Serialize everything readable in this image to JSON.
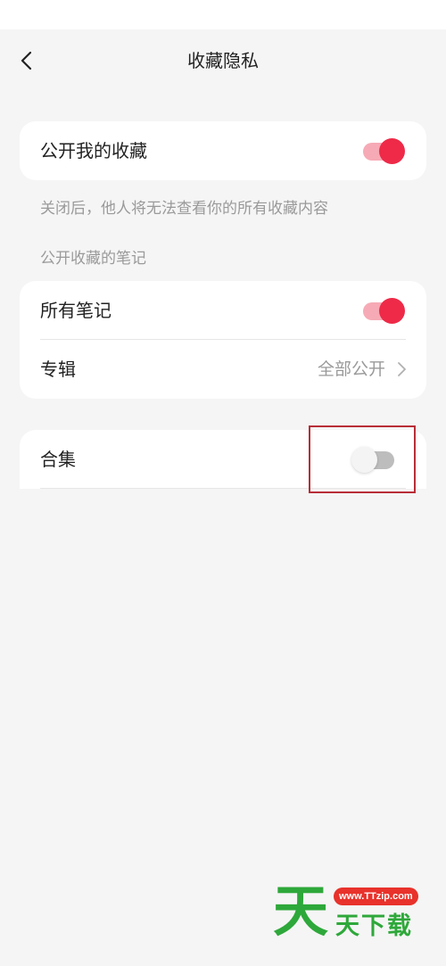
{
  "header": {
    "title": "收藏隐私",
    "back_icon": "chevron-left-icon"
  },
  "public_favorites": {
    "label": "公开我的收藏",
    "enabled": true,
    "hint": "关闭后，他人将无法查看你的所有收藏内容"
  },
  "notes_section": {
    "heading": "公开收藏的笔记",
    "all_notes": {
      "label": "所有笔记",
      "enabled": true
    },
    "album": {
      "label": "专辑",
      "value": "全部公开"
    }
  },
  "collection": {
    "label": "合集",
    "enabled": false
  },
  "watermark": {
    "big": "天",
    "url": "www.TTzip.com",
    "small": "天下载"
  },
  "colors": {
    "accent": "#ee2a48",
    "accent_track": "#f6aab5",
    "highlight_box": "#b82e37",
    "watermark_green": "#2ea83a",
    "watermark_red": "#e8322b"
  }
}
